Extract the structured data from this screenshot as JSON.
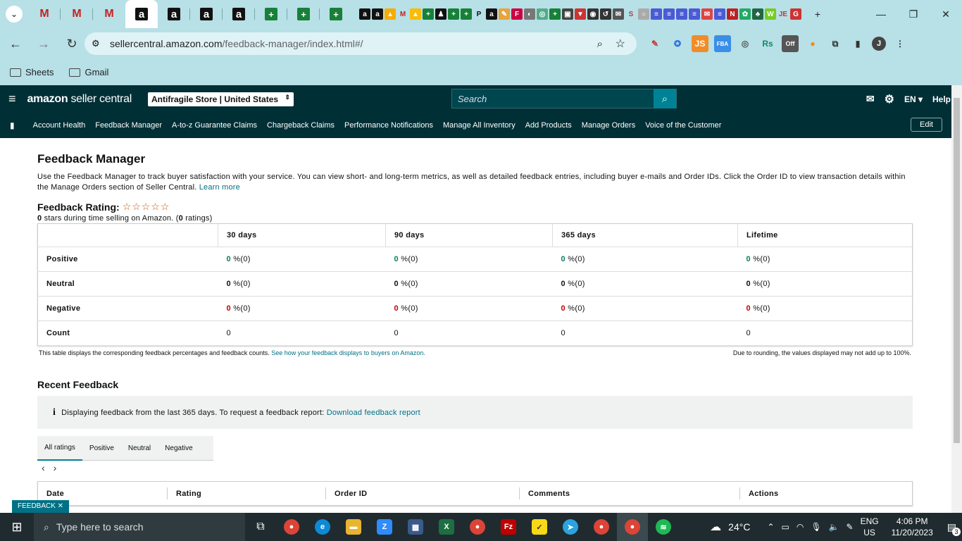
{
  "browser": {
    "url_host": "sellercentral.amazon.com",
    "url_path": "/feedback-manager/index.html#/",
    "bookmarks": [
      "Sheets",
      "Gmail"
    ],
    "profile_initial": "J"
  },
  "app": {
    "logo_bold": "amazon",
    "logo_rest": " seller central",
    "store": "Antifragile Store | United States",
    "search_placeholder": "Search",
    "language": "EN",
    "help": "Help",
    "nav": [
      "Account Health",
      "Feedback Manager",
      "A-to-z Guarantee Claims",
      "Chargeback Claims",
      "Performance Notifications",
      "Manage All Inventory",
      "Add Products",
      "Manage Orders",
      "Voice of the Customer"
    ],
    "edit": "Edit"
  },
  "page": {
    "title": "Feedback Manager",
    "description": "Use the Feedback Manager to track buyer satisfaction with your service. You can view short- and long-term metrics, as well as detailed feedback entries, including buyer e-mails and Order IDs. Click the Order ID to view transaction details within the Manage Orders section of Seller Central.",
    "learn_more": "Learn more",
    "rating_label": "Feedback Rating:",
    "stars": "☆☆☆☆☆",
    "rating_stars_value": "0",
    "rating_text_mid": " stars during time selling on Amazon. (",
    "rating_count": "0",
    "rating_text_end": " ratings)",
    "table": {
      "columns": [
        "30 days",
        "90 days",
        "365 days",
        "Lifetime"
      ],
      "rows": [
        {
          "label": "Positive",
          "values": [
            "0",
            "0",
            "0",
            "0"
          ],
          "suffix": " %(0)"
        },
        {
          "label": "Neutral",
          "values": [
            "0",
            "0",
            "0",
            "0"
          ],
          "suffix": " %(0)"
        },
        {
          "label": "Negative",
          "values": [
            "0",
            "0",
            "0",
            "0"
          ],
          "suffix": " %(0)"
        },
        {
          "label": "Count",
          "values": [
            "0",
            "0",
            "0",
            "0"
          ],
          "suffix": ""
        }
      ]
    },
    "note_left": "This table displays the corresponding feedback percentages and feedback counts.",
    "note_link": "See how your feedback displays to buyers on Amazon.",
    "note_right": "Due to rounding, the values displayed may not add up to 100%.",
    "recent_title": "Recent Feedback",
    "info_text": "Displaying feedback from the last 365 days. To request a feedback report:",
    "info_link": "Download feedback report",
    "tabs": [
      "All ratings",
      "Positive",
      "Neutral",
      "Negative"
    ],
    "fb_columns": [
      "Date",
      "Rating",
      "Order ID",
      "Comments",
      "Actions"
    ],
    "feedback_tag": "FEEDBACK ✕"
  },
  "taskbar": {
    "search_placeholder": "Type here to search",
    "weather": "24°C",
    "lang1": "ENG",
    "lang2": "US",
    "time": "4:06 PM",
    "date": "11/20/2023",
    "notifications": "3"
  }
}
